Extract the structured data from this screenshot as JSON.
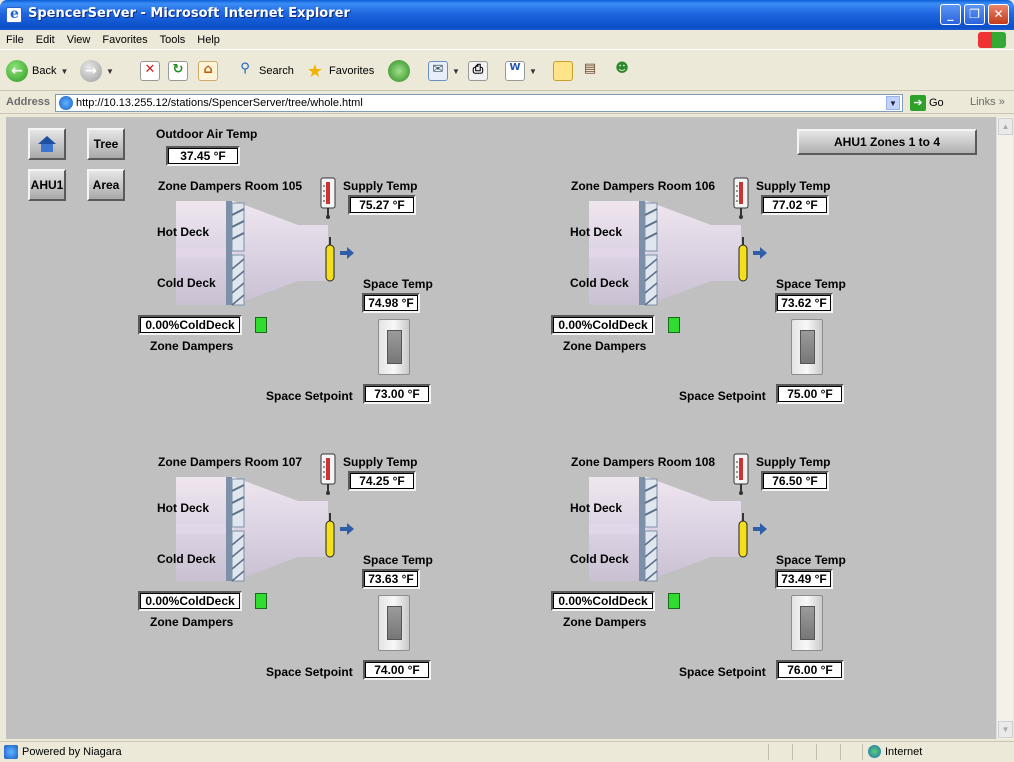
{
  "window": {
    "title": "SpencerServer - Microsoft Internet Explorer"
  },
  "menu": [
    "File",
    "Edit",
    "View",
    "Favorites",
    "Tools",
    "Help"
  ],
  "toolbar": {
    "back": "Back",
    "search": "Search",
    "favorites": "Favorites"
  },
  "address": {
    "label": "Address",
    "url": "http://10.13.255.12/stations/SpencerServer/tree/whole.html",
    "go": "Go",
    "links": "Links"
  },
  "status": {
    "text": "Powered by Niagara",
    "zone": "Internet"
  },
  "page": {
    "nav": {
      "tree": "Tree",
      "ahu1": "AHU1",
      "area": "Area"
    },
    "outdoor_air_temp_label": "Outdoor Air Temp",
    "outdoor_air_temp": "37.45 °F",
    "zones_button": "AHU1 Zones 1 to 4",
    "labels": {
      "supply_temp": "Supply Temp",
      "hot_deck": "Hot Deck",
      "cold_deck": "Cold Deck",
      "space_temp": "Space Temp",
      "zone_dampers": "Zone Dampers",
      "space_setpoint": "Space Setpoint"
    },
    "zones": [
      {
        "title": "Zone Dampers Room 105",
        "supply_temp": "75.27 °F",
        "space_temp": "74.98 °F",
        "damper": "0.00%ColdDeck",
        "setpoint": "73.00 °F"
      },
      {
        "title": "Zone Dampers Room 106",
        "supply_temp": "77.02 °F",
        "space_temp": "73.62 °F",
        "damper": "0.00%ColdDeck",
        "setpoint": "75.00 °F"
      },
      {
        "title": "Zone Dampers Room 107",
        "supply_temp": "74.25 °F",
        "space_temp": "73.63 °F",
        "damper": "0.00%ColdDeck",
        "setpoint": "74.00 °F"
      },
      {
        "title": "Zone Dampers Room 108",
        "supply_temp": "76.50 °F",
        "space_temp": "73.49 °F",
        "damper": "0.00%ColdDeck",
        "setpoint": "76.00 °F"
      }
    ]
  }
}
